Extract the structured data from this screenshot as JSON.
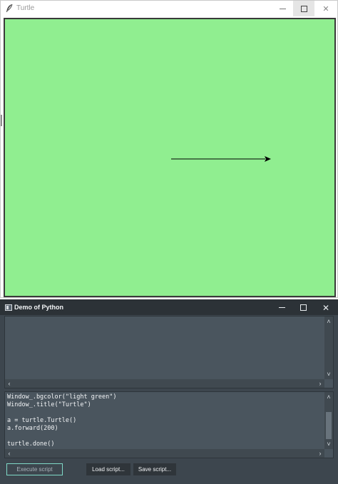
{
  "turtle_window": {
    "title": "Turtle",
    "controls": {
      "minimize": "minimize",
      "maximize": "maximize",
      "close": "✕"
    },
    "canvas": {
      "background": "#90ee90",
      "turtle": {
        "heading": "east",
        "forward": 200,
        "pen_color": "#000000"
      }
    }
  },
  "demo_window": {
    "title": "Demo of Python",
    "controls": {
      "close": "✕"
    },
    "output_text": "",
    "script_lines": [
      "Window_.bgcolor(\"light green\")",
      "Window_.title(\"Turtle\")",
      "",
      "a = turtle.Turtle()",
      "a.forward(200)",
      "",
      "turtle.done()"
    ],
    "buttons": {
      "execute": "Execute script",
      "load": "Load script...",
      "save": "Save script..."
    }
  },
  "colors": {
    "canvas_bg": "#90ee90",
    "demo_bg": "#3d464e",
    "panel_bg": "#4a555e",
    "accent_border": "#7fd9c8"
  }
}
